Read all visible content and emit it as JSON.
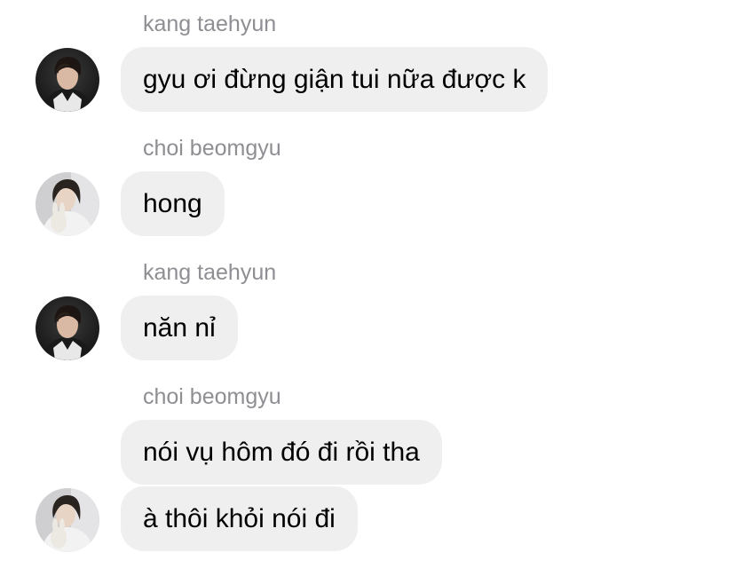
{
  "messages": [
    {
      "sender": "kang taehyun",
      "text": "gyu ơi đừng giận tui nữa được k",
      "avatar": "taehyun-avatar"
    },
    {
      "sender": "choi beomgyu",
      "text": "hong",
      "avatar": "beomgyu-avatar"
    },
    {
      "sender": "kang taehyun",
      "text": "năn nỉ",
      "avatar": "taehyun-avatar"
    },
    {
      "sender": "choi beomgyu",
      "texts": [
        "nói vụ hôm đó đi rồi tha",
        "à thôi khỏi nói đi"
      ],
      "avatar": "beomgyu-avatar"
    }
  ],
  "colors": {
    "bubble": "#efeff0",
    "sender_name": "#8e8e93",
    "text": "#000000"
  }
}
